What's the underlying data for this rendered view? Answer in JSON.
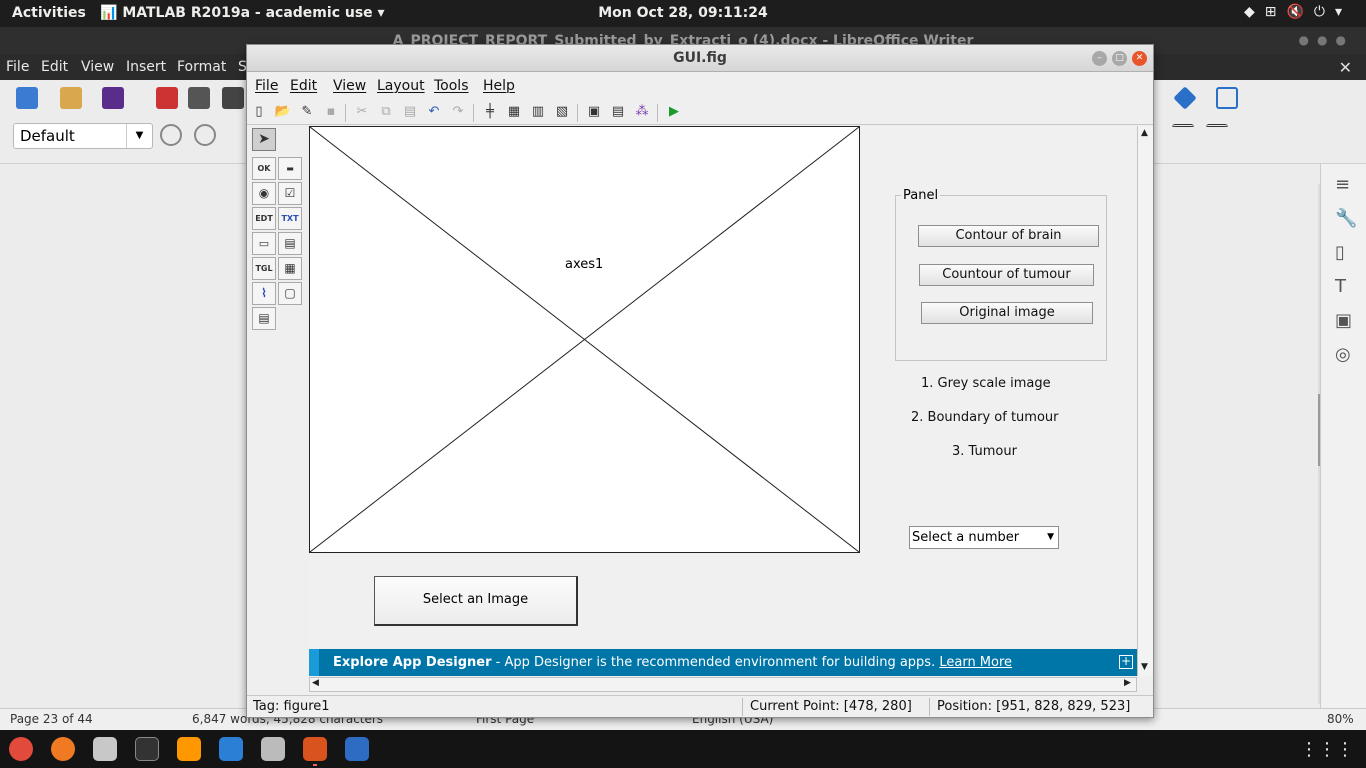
{
  "topbar": {
    "activities": "Activities",
    "app_menu": "MATLAB R2019a - academic use",
    "clock": "Mon Oct 28, 09:11:24",
    "tray_icons": [
      "network-icon",
      "volume-icon",
      "power-icon"
    ]
  },
  "libreoffice": {
    "title": "A_PROJECT_REPORT_Submitted_by_Extracti_o (4).docx - LibreOffice Writer",
    "menu": [
      "File",
      "Edit",
      "View",
      "Insert",
      "Format",
      "S"
    ],
    "paragraph_style": "Default",
    "status": {
      "page": "Page 23 of 44",
      "words": "6,847 words, 45,828 characters",
      "page_style": "First Page",
      "language": "English (USA)",
      "zoom": "80%"
    }
  },
  "guide": {
    "title": "GUI.fig",
    "menu": [
      "File",
      "Edit",
      "View",
      "Layout",
      "Tools",
      "Help"
    ],
    "axes_label": "axes1",
    "panel_title": "Panel",
    "panel_buttons": [
      "Contour of brain",
      "Countour of tumour",
      "Original image"
    ],
    "static_texts": [
      "1. Grey scale image",
      "2. Boundary of tumour",
      "3. Tumour"
    ],
    "popup_value": "Select a number",
    "select_button": "Select an Image",
    "banner": {
      "title": "Explore App Designer",
      "text": " - App Designer is the recommended environment for building apps. ",
      "link": "Learn More"
    },
    "status": {
      "tag": "Tag: figure1",
      "current_point": "Current Point:  [478, 280]",
      "position": "Position: [951, 828, 829, 523]"
    }
  },
  "colors": {
    "banner": "#0076a8",
    "close_button": "#e9542b",
    "topbar": "#1d1d1d"
  }
}
